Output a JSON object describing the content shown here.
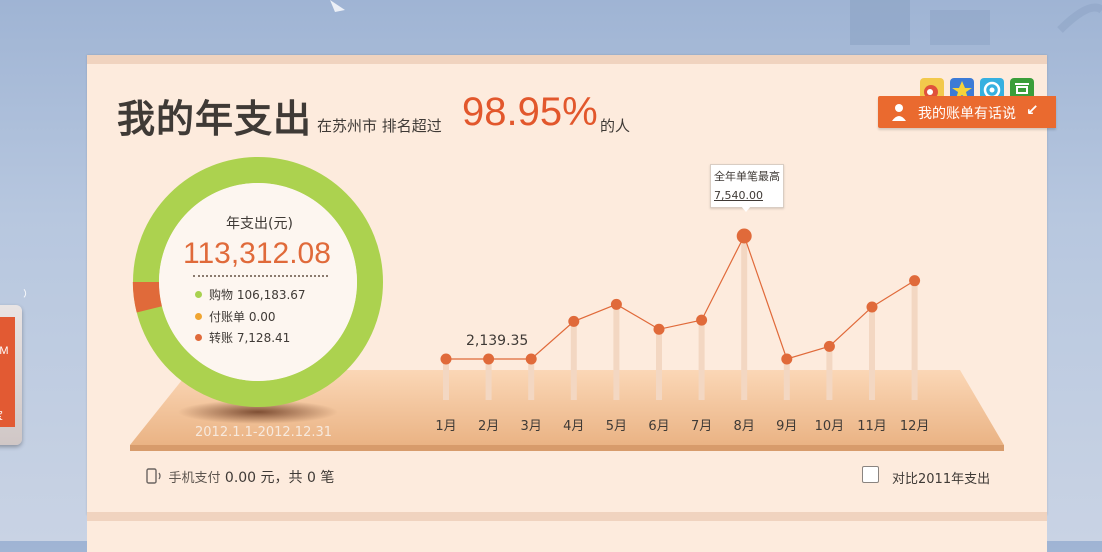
{
  "header": {
    "title": "我的年支出",
    "city_text": "在苏州市 排名超过",
    "percentile": "98.95%",
    "suffix": "的人"
  },
  "share_icons": [
    "weibo-icon",
    "star-icon",
    "qzone-icon",
    "douban-icon"
  ],
  "bill_button": {
    "label": "我的账单有话说"
  },
  "summary": {
    "title": "年支出(元)",
    "total": "113,312.08",
    "date_range": "2012.1.1-2012.12.31",
    "breakdown": [
      {
        "label": "购物",
        "value": "106,183.67",
        "color": "#a8d14f"
      },
      {
        "label": "付账单",
        "value": "0.00",
        "color": "#f0a531"
      },
      {
        "label": "转账",
        "value": "7,128.41",
        "color": "#e06a3a"
      }
    ]
  },
  "chart_data": {
    "type": "line",
    "categories": [
      "1月",
      "2月",
      "3月",
      "4月",
      "5月",
      "6月",
      "7月",
      "8月",
      "9月",
      "10月",
      "11月",
      "12月"
    ],
    "series": [
      {
        "values": [
          2139.35,
          2139.35,
          2139.35,
          5000,
          6300,
          4400,
          5100,
          11500,
          2139.35,
          3100,
          6100,
          8100
        ]
      }
    ],
    "annotations": [
      {
        "category": "2月",
        "text": "2,139.35"
      }
    ],
    "tooltip": {
      "title": "全年单笔最高",
      "value": "7,540.00",
      "category": "8月"
    },
    "accent_color": "#e06a3a"
  },
  "footer": {
    "mobile_pay_label": "手机支付",
    "mobile_pay_value": "0.00 元，共 0 笔",
    "compare_label": "对比2011年支出"
  },
  "left_widget": {
    "text_top": "PM",
    "text_bottom": "宝"
  }
}
